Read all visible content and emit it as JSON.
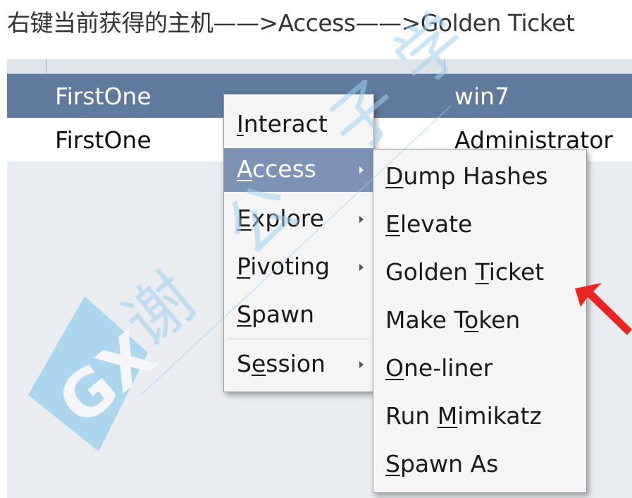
{
  "caption": "右键当前获得的主机——>Access——>Golden Ticket",
  "table": {
    "rows": [
      {
        "name": "FirstOne",
        "user": "win7",
        "selected": true
      },
      {
        "name": "FirstOne",
        "user": "Administrator",
        "selected": false
      }
    ]
  },
  "context_menu": {
    "items": [
      {
        "pre": "",
        "ul": "I",
        "post": "nteract",
        "submenu": false
      },
      {
        "pre": "",
        "ul": "A",
        "post": "ccess",
        "submenu": true,
        "active": true
      },
      {
        "pre": "",
        "ul": "E",
        "post": "xplore",
        "submenu": true
      },
      {
        "pre": "",
        "ul": "P",
        "post": "ivoting",
        "submenu": true
      },
      {
        "pre": "",
        "ul": "S",
        "post": "pawn",
        "submenu": false
      },
      {
        "pre": "S",
        "ul": "e",
        "post": "ssion",
        "submenu": true
      }
    ]
  },
  "access_submenu": {
    "items": [
      {
        "pre": "",
        "ul": "D",
        "post": "ump Hashes"
      },
      {
        "pre": "",
        "ul": "E",
        "post": "levate"
      },
      {
        "pre": "Golden ",
        "ul": "T",
        "post": "icket"
      },
      {
        "pre": "Make T",
        "ul": "o",
        "post": "ken"
      },
      {
        "pre": "",
        "ul": "O",
        "post": "ne-liner"
      },
      {
        "pre": "Run ",
        "ul": "M",
        "post": "imikatz"
      },
      {
        "pre": "",
        "ul": "S",
        "post": "pawn As"
      }
    ]
  },
  "colors": {
    "selected_row": "#5f7a9c",
    "menu_highlight": "#7d93b5",
    "arrow_red": "#e8261f",
    "watermark": "#9fd2ee"
  },
  "watermark_text": "谢公子学安全"
}
